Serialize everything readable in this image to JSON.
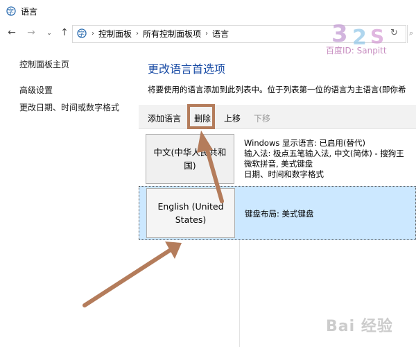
{
  "window": {
    "title": "语言"
  },
  "address_bar": {
    "breadcrumbs": [
      "控制面板",
      "所有控制面板项",
      "语言"
    ]
  },
  "left_panel": {
    "links": [
      "控制面板主页",
      "高级设置",
      "更改日期、时间或数字格式"
    ]
  },
  "main": {
    "title": "更改语言首选项",
    "description": "将要使用的语言添加到此列表中。位于列表第一位的语言为主语言(即你希"
  },
  "toolbar": {
    "add_label": "添加语言",
    "delete_label": "删除",
    "up_label": "上移",
    "down_label": "下移"
  },
  "languages": [
    {
      "name": "中文(中华人民共和国)",
      "details": [
        "Windows 显示语言: 已启用(替代)",
        "输入法: 极点五笔输入法, 中文(简体) - 搜狗王",
        "微软拼音, 美式键盘",
        "日期、时间和数字格式"
      ]
    },
    {
      "name": "English (United States)",
      "details": [
        "键盘布局: 美式键盘"
      ]
    }
  ],
  "watermark": {
    "top_text": "百度ID: Sanpitt",
    "bottom_text": "Bai 经验"
  },
  "colors": {
    "title_blue": "#1c4ea6",
    "selection_bg": "#cce8ff",
    "annotation": "#b47c5b",
    "toolbar_bg": "#f2f2f2"
  }
}
